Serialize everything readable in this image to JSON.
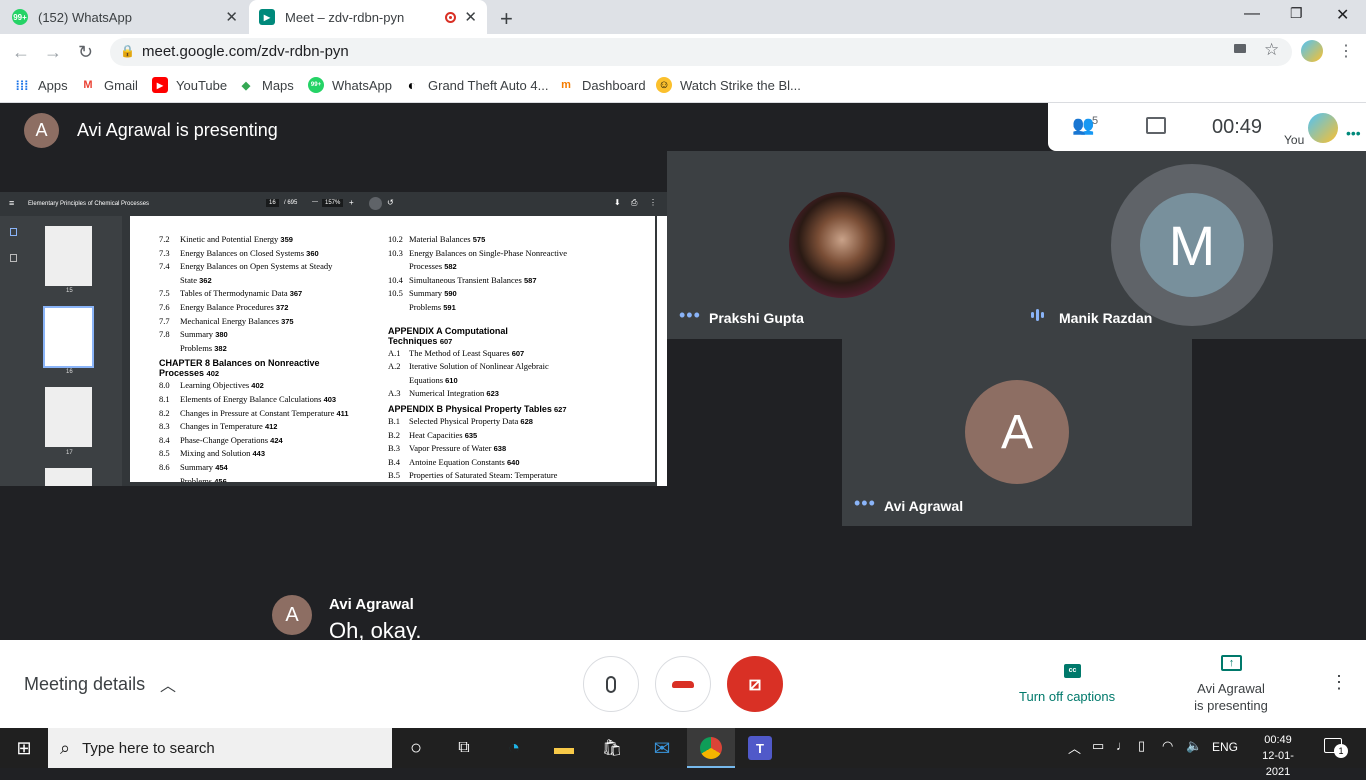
{
  "browser": {
    "tabs": [
      {
        "title": "(152) WhatsApp",
        "badge": "99+"
      },
      {
        "title": "Meet – zdv-rdbn-pyn"
      }
    ],
    "url": "meet.google.com/zdv-rdbn-pyn",
    "bookmarks": [
      "Apps",
      "Gmail",
      "YouTube",
      "Maps",
      "WhatsApp",
      "Grand Theft Auto 4...",
      "Dashboard",
      "Watch Strike the Bl..."
    ]
  },
  "meet": {
    "presenter_initial": "A",
    "presenting_banner": "Avi Agrawal is presenting",
    "participants_count": "5",
    "timer": "00:49",
    "you_label": "You",
    "participants": [
      {
        "name": "Prakshi Gupta"
      },
      {
        "name": "Manik Razdan",
        "initial": "M"
      },
      {
        "name": "Avi Agrawal",
        "initial": "A"
      }
    ],
    "caption": {
      "initial": "A",
      "speaker": "Avi Agrawal",
      "text": "Oh, okay."
    },
    "bottom": {
      "meeting_details": "Meeting details",
      "captions_label": "Turn off captions",
      "presenting_label_1": "Avi Agrawal",
      "presenting_label_2": "is presenting"
    }
  },
  "pdf": {
    "title": "Elementary Principles of Chemical Processes",
    "page": "16",
    "pages": "/ 695",
    "zoom": "157%",
    "thumb_labels": [
      "15",
      "16",
      "17"
    ],
    "left_col": [
      [
        "7.2",
        "Kinetic and Potential Energy",
        "359"
      ],
      [
        "7.3",
        "Energy Balances on Closed Systems",
        "360"
      ],
      [
        "7.4",
        "Energy Balances on Open Systems at Steady",
        ""
      ],
      [
        "",
        "State",
        "362"
      ],
      [
        "7.5",
        "Tables of Thermodynamic Data",
        "367"
      ],
      [
        "7.6",
        "Energy Balance Procedures",
        "372"
      ],
      [
        "7.7",
        "Mechanical Energy Balances",
        "375"
      ],
      [
        "7.8",
        "Summary",
        "380"
      ],
      [
        "",
        "Problems",
        "382"
      ]
    ],
    "chapter8": "CHAPTER 8  Balances on Nonreactive",
    "chapter8b": "Processes",
    "chapter8_page": "402",
    "left_col2": [
      [
        "8.0",
        "Learning Objectives",
        "402"
      ],
      [
        "8.1",
        "Elements of Energy Balance Calculations",
        "403"
      ],
      [
        "8.2",
        "Changes in Pressure at Constant Temperature",
        "411"
      ],
      [
        "8.3",
        "Changes in Temperature",
        "412"
      ],
      [
        "8.4",
        "Phase-Change Operations",
        "424"
      ],
      [
        "8.5",
        "Mixing and Solution",
        "443"
      ],
      [
        "8.6",
        "Summary",
        "454"
      ],
      [
        "",
        "Problems",
        "456"
      ]
    ],
    "right_col": [
      [
        "10.2",
        "Material Balances",
        "575"
      ],
      [
        "10.3",
        "Energy Balances on Single-Phase Nonreactive",
        ""
      ],
      [
        "",
        "Processes",
        "582"
      ],
      [
        "10.4",
        "Simultaneous Transient Balances",
        "587"
      ],
      [
        "10.5",
        "Summary",
        "590"
      ],
      [
        "",
        "Problems",
        "591"
      ]
    ],
    "appA": "APPENDIX A  Computational",
    "appAb": "Techniques",
    "appA_page": "607",
    "right_col2": [
      [
        "A.1",
        "The Method of Least Squares",
        "607"
      ],
      [
        "A.2",
        "Iterative Solution of Nonlinear Algebraic",
        ""
      ],
      [
        "",
        "Equations",
        "610"
      ],
      [
        "A.3",
        "Numerical Integration",
        "623"
      ]
    ],
    "appB": "APPENDIX B  Physical Property Tables",
    "appB_page": "627",
    "right_col3": [
      [
        "B.1",
        "Selected Physical Property Data",
        "628"
      ],
      [
        "B.2",
        "Heat Capacities",
        "635"
      ],
      [
        "B.3",
        "Vapor Pressure of Water",
        "638"
      ],
      [
        "B.4",
        "Antoine Equation Constants",
        "640"
      ],
      [
        "B.5",
        "Properties of Saturated Steam: Temperature",
        ""
      ]
    ]
  },
  "taskbar": {
    "search_placeholder": "Type here to search",
    "lang": "ENG",
    "time": "00:49",
    "date": "12-01-2021",
    "notif_count": "1"
  },
  "colors": {
    "end_call": "#d93025",
    "meet_bg": "#202124",
    "accent": "#1a73e8",
    "teal": "#00796b"
  }
}
